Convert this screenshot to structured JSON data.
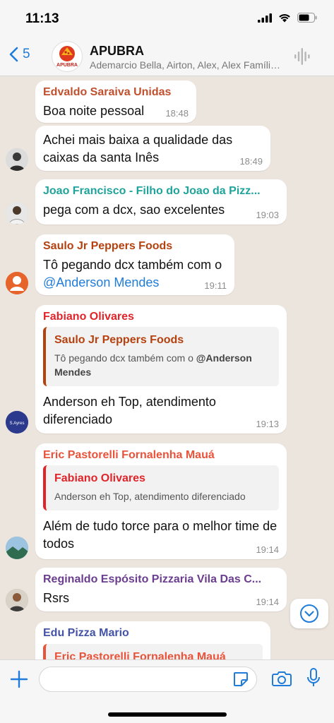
{
  "status": {
    "time": "11:13"
  },
  "header": {
    "back_count": "5",
    "title": "APUBRA",
    "members": "Ademarcio Bella, Airton, Alex, Alex Família, Alex Lacerda, Alexandre",
    "avatar_logo_text": "APUBRA"
  },
  "messages": [
    {
      "sender": "Edvaldo Saraiva Unidas",
      "sender_color": "#c0502e",
      "text": "Boa noite pessoal",
      "time": "18:48"
    },
    {
      "text": "Achei mais baixa a qualidade das caixas da santa Inês",
      "time": "18:49"
    },
    {
      "sender": "Joao Francisco - Filho do Joao da Pizz...",
      "sender_color": "#1fa39a",
      "text": "pega com a dcx, sao excelentes",
      "time": "19:03"
    },
    {
      "sender": "Saulo Jr Peppers Foods",
      "sender_color": "#b5410f",
      "text_before": "Tô pegando dcx também com o ",
      "mention": "@Anderson Mendes",
      "time": "19:11"
    },
    {
      "sender": "Fabiano Olivares",
      "sender_color": "#e0242a",
      "quote": {
        "sender": "Saulo Jr Peppers Foods",
        "sender_color": "#b5410f",
        "text_before": "Tô pegando dcx também com o ",
        "mention": "@Anderson Mendes"
      },
      "text": "Anderson eh Top, atendimento diferenciado",
      "time": "19:13"
    },
    {
      "sender": "Eric Pastorelli Fornalenha Mauá",
      "sender_color": "#e8533a",
      "quote": {
        "sender": "Fabiano Olivares",
        "sender_color": "#e0242a",
        "text": "Anderson eh Top, atendimento diferenciado"
      },
      "text": "Além de tudo torce para o melhor time de todos",
      "time": "19:14"
    },
    {
      "sender": "Reginaldo Espósito Pizzaria Vila Das C...",
      "sender_color": "#6a3d8f",
      "text": "Rsrs",
      "time": "19:14"
    },
    {
      "sender": "Edu Pizza Mario",
      "sender_color": "#4453a6",
      "quote": {
        "sender": "Eric Pastorelli Fornalenha Mauá",
        "sender_color": "#e8533a"
      }
    }
  ],
  "avatars": {
    "business_logo_text": "S.Ayres"
  },
  "composer": {
    "placeholder": ""
  },
  "colors": {
    "accent": "#1f7cdb",
    "background": "#ece5dd"
  }
}
